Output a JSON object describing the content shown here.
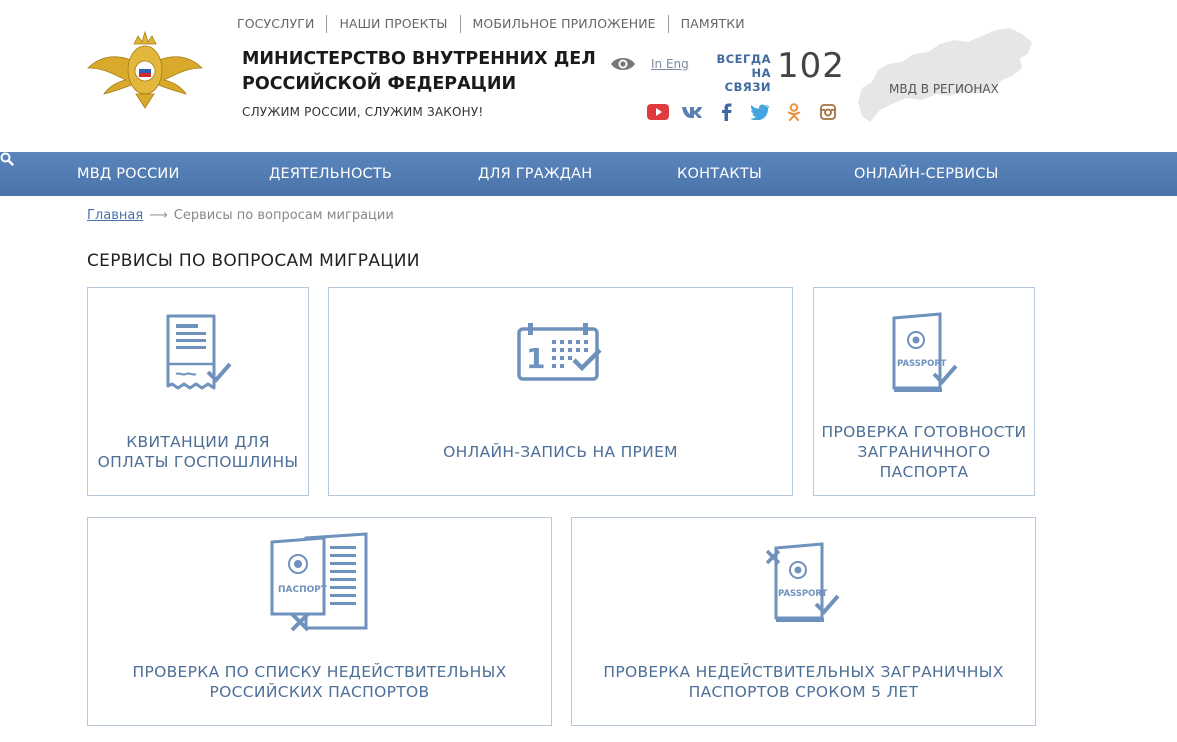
{
  "header": {
    "top_links": [
      "ГОСУСЛУГИ",
      "НАШИ ПРОЕКТЫ",
      "МОБИЛЬНОЕ ПРИЛОЖЕНИЕ",
      "ПАМЯТКИ"
    ],
    "ministry_line1": "МИНИСТЕРСТВО ВНУТРЕННИХ ДЕЛ",
    "ministry_line2": "РОССИЙСКОЙ ФЕДЕРАЦИИ",
    "motto": "СЛУЖИМ РОССИИ, СЛУЖИМ ЗАКОНУ!",
    "lang_link": "In Eng",
    "always_line1": "ВСЕГДА",
    "always_line2": "НА СВЯЗИ",
    "phone": "102",
    "regions_label": "МВД В РЕГИОНАХ",
    "socials": [
      "youtube-icon",
      "vk-icon",
      "facebook-icon",
      "twitter-icon",
      "odnoklassniki-icon",
      "instagram-icon"
    ]
  },
  "nav": {
    "items": [
      "МВД РОССИИ",
      "ДЕЯТЕЛЬНОСТЬ",
      "ДЛЯ ГРАЖДАН",
      "КОНТАКТЫ",
      "ОНЛАЙН-СЕРВИСЫ"
    ]
  },
  "breadcrumb": {
    "home": "Главная",
    "current": "Сервисы по вопросам миграции"
  },
  "page_title": "СЕРВИСЫ ПО ВОПРОСАМ МИГРАЦИИ",
  "tiles": [
    {
      "line1": "КВИТАНЦИИ ДЛЯ",
      "line2": "ОПЛАТЫ ГОСПОШЛИНЫ",
      "line3": ""
    },
    {
      "line1": "ОНЛАЙН-ЗАПИСЬ НА ПРИЕМ",
      "line2": "",
      "line3": ""
    },
    {
      "line1": "ПРОВЕРКА ГОТОВНОСТИ",
      "line2": "ЗАГРАНИЧНОГО",
      "line3": "ПАСПОРТА"
    },
    {
      "line1": "ПРОВЕРКА ПО СПИСКУ НЕДЕЙСТВИТЕЛЬНЫХ",
      "line2": "РОССИЙСКИХ ПАСПОРТОВ",
      "line3": ""
    },
    {
      "line1": "ПРОВЕРКА НЕДЕЙСТВИТЕЛЬНЫХ ЗАГРАНИЧНЫХ",
      "line2": "ПАСПОРТОВ СРОКОМ 5 ЛЕТ",
      "line3": ""
    }
  ],
  "icon_texts": {
    "calendar_day": "1",
    "passport_en": "PASSPORT",
    "passport_ru": "ПАСПОРТ"
  },
  "colors": {
    "nav_bg": "#4f7ab1",
    "tile_border": "#b5c7dc",
    "tile_text": "#4d6f98",
    "icon": "#6f92bd"
  }
}
